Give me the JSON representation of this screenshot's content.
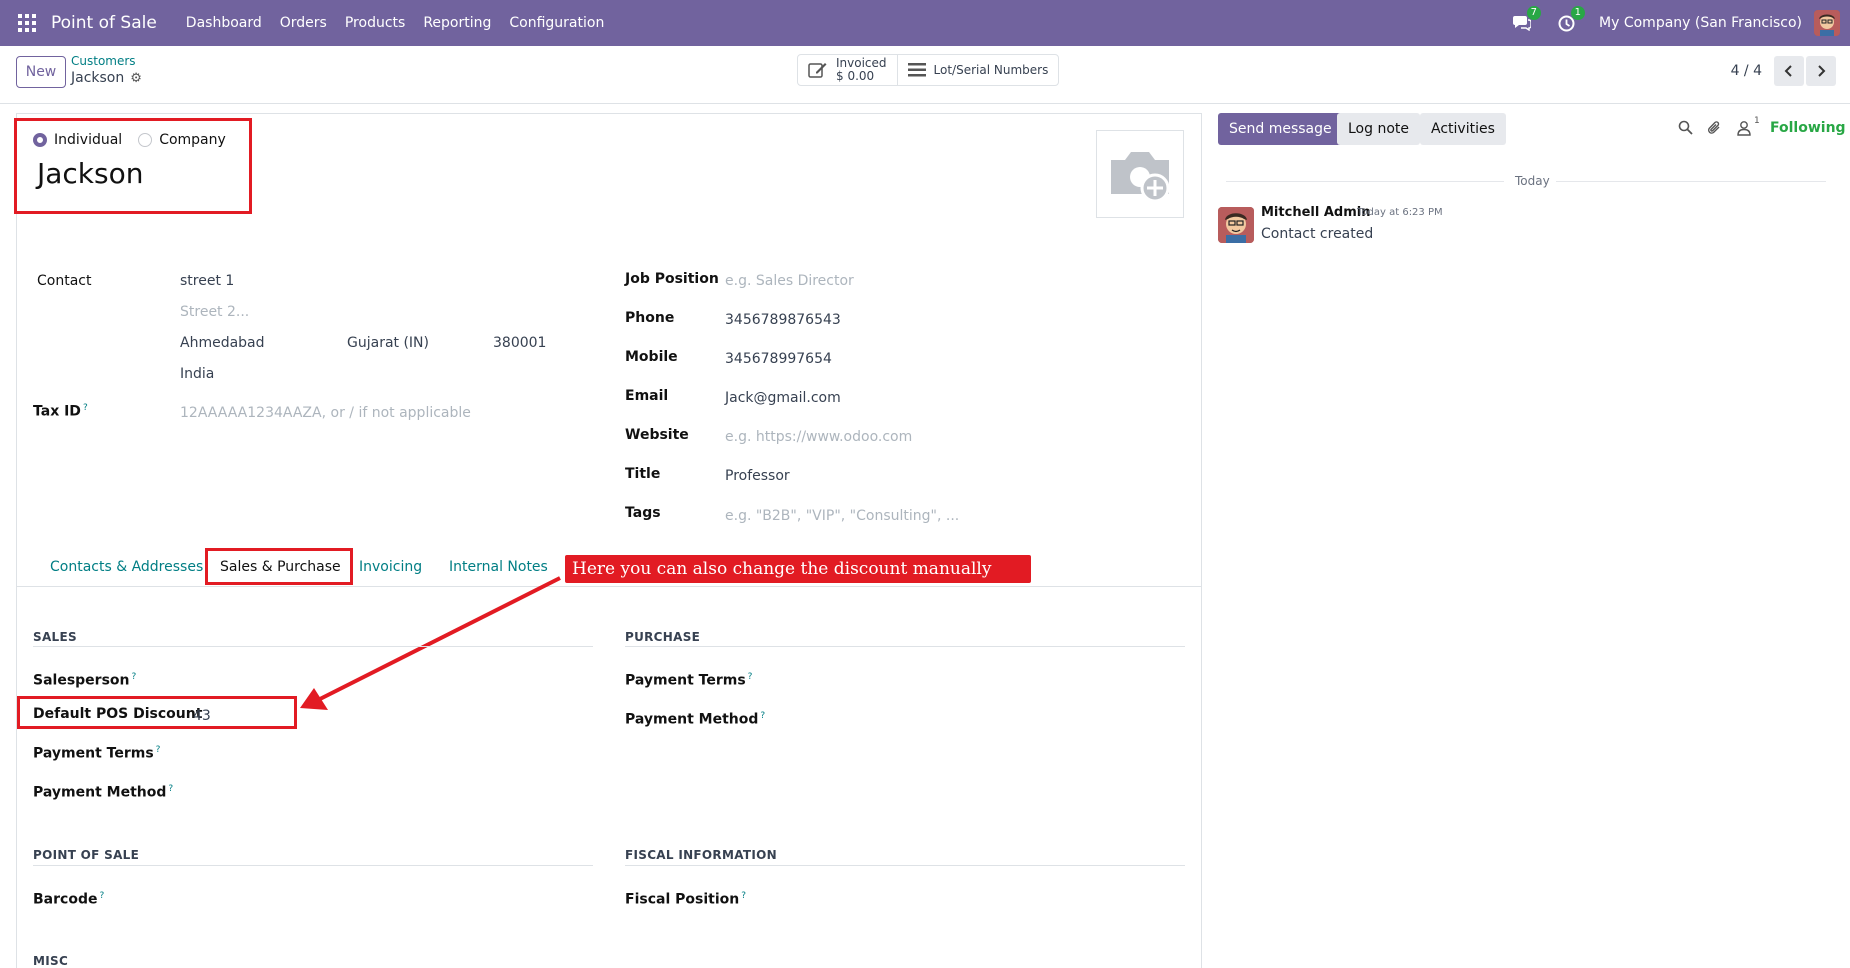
{
  "navbar": {
    "app_name": "Point of Sale",
    "menu": [
      "Dashboard",
      "Orders",
      "Products",
      "Reporting",
      "Configuration"
    ],
    "messages_count": "7",
    "activities_count": "1",
    "company": "My Company (San Francisco)",
    "bg_color": "#71639e"
  },
  "control_panel": {
    "new_label": "New",
    "breadcrumb_parent": "Customers",
    "breadcrumb_current": "Jackson",
    "smart_invoiced_label": "Invoiced",
    "smart_invoiced_value": "$ 0.00",
    "smart_lots_label": "Lot/Serial Numbers",
    "pager": "4 / 4"
  },
  "form": {
    "type_individual": "Individual",
    "type_company": "Company",
    "selected_type": "Individual",
    "name": "Jackson",
    "contact_label": "Contact",
    "street": "street 1",
    "street2_placeholder": "Street 2...",
    "city": "Ahmedabad",
    "state": "Gujarat (IN)",
    "zip": "380001",
    "country": "India",
    "tax_id_label": "Tax ID",
    "tax_id_placeholder": "12AAAAA1234AAZA, or / if not applicable",
    "job_position_label": "Job Position",
    "job_position_placeholder": "e.g. Sales Director",
    "phone_label": "Phone",
    "phone": "3456789876543",
    "mobile_label": "Mobile",
    "mobile": "345678997654",
    "email_label": "Email",
    "email": "Jack@gmail.com",
    "website_label": "Website",
    "website_placeholder": "e.g. https://www.odoo.com",
    "title_label": "Title",
    "title": "Professor",
    "tags_label": "Tags",
    "tags_placeholder": "e.g. \"B2B\", \"VIP\", \"Consulting\", ...",
    "help_mark": "?"
  },
  "tabs": [
    "Contacts & Addresses",
    "Sales & Purchase",
    "Invoicing",
    "Internal Notes"
  ],
  "active_tab": "Sales & Purchase",
  "sales_purchase": {
    "sales_title": "SALES",
    "salesperson_label": "Salesperson",
    "pos_discount_label": "Default POS Discount",
    "pos_discount_value": "43",
    "payment_terms_label": "Payment Terms",
    "payment_method_label": "Payment Method",
    "purchase_title": "PURCHASE",
    "purchase_payment_terms_label": "Payment Terms",
    "purchase_payment_method_label": "Payment Method",
    "pos_title": "POINT OF SALE",
    "barcode_label": "Barcode",
    "fiscal_title": "FISCAL INFORMATION",
    "fiscal_position_label": "Fiscal Position",
    "misc_title": "MISC"
  },
  "annotation": {
    "callout_text": "Here you can also change the discount manually",
    "color": "#e21b23"
  },
  "chatter": {
    "send_message": "Send message",
    "log_note": "Log note",
    "activities": "Activities",
    "followers_count": "1",
    "following": "Following",
    "date_separator": "Today",
    "message_author": "Mitchell Admin",
    "message_time": "Today at 6:23 PM",
    "message_body": "Contact created"
  }
}
